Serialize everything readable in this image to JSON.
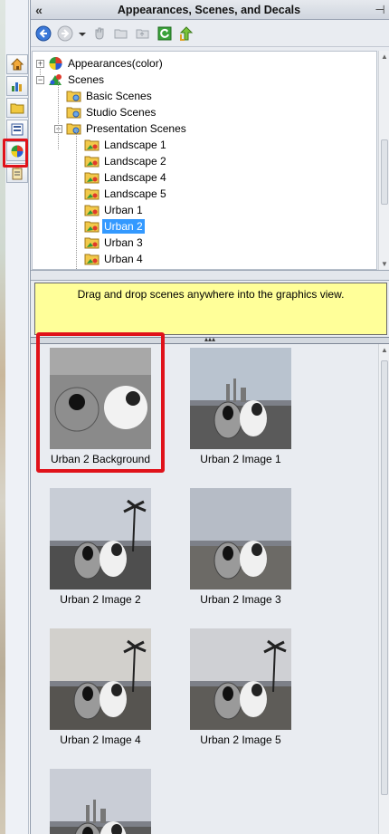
{
  "panel": {
    "title": "Appearances, Scenes, and Decals",
    "collapse_glyph": "«",
    "pin_glyph": "⊣"
  },
  "toolbar": {
    "buttons": [
      "back-icon",
      "forward-icon",
      "dropdown-arrow-icon",
      "pan-icon",
      "open-folder-icon",
      "folder-up-icon",
      "refresh-icon",
      "up-level-icon"
    ]
  },
  "sidebar_tabs": [
    "home-icon",
    "chart-icon",
    "folder-icon",
    "list-icon",
    "appearances-icon",
    "clipboard-icon"
  ],
  "tree": {
    "items": [
      {
        "label": "Appearances(color)",
        "expander": "+"
      },
      {
        "label": "Scenes",
        "expander": "−"
      },
      {
        "label": "Basic Scenes"
      },
      {
        "label": "Studio Scenes"
      },
      {
        "label": "Presentation Scenes",
        "expander": "−"
      },
      {
        "label": "Landscape 1"
      },
      {
        "label": "Landscape 2"
      },
      {
        "label": "Landscape 4"
      },
      {
        "label": "Landscape 5"
      },
      {
        "label": "Urban 1"
      },
      {
        "label": "Urban 2",
        "selected": true
      },
      {
        "label": "Urban 3"
      },
      {
        "label": "Urban 4"
      }
    ]
  },
  "hint": {
    "text": "Drag and drop scenes anywhere into the graphics view."
  },
  "gallery": {
    "items": [
      {
        "caption": "Urban 2 Background",
        "highlighted": true
      },
      {
        "caption": "Urban 2 Image 1"
      },
      {
        "caption": "Urban 2 Image 2"
      },
      {
        "caption": "Urban 2 Image 3"
      },
      {
        "caption": "Urban 2 Image 4"
      },
      {
        "caption": "Urban 2 Image 5"
      },
      {
        "caption": ""
      }
    ]
  },
  "colors": {
    "highlight_red": "#e0121a",
    "selection_blue": "#3399ff",
    "hint_yellow": "#ffff99"
  }
}
